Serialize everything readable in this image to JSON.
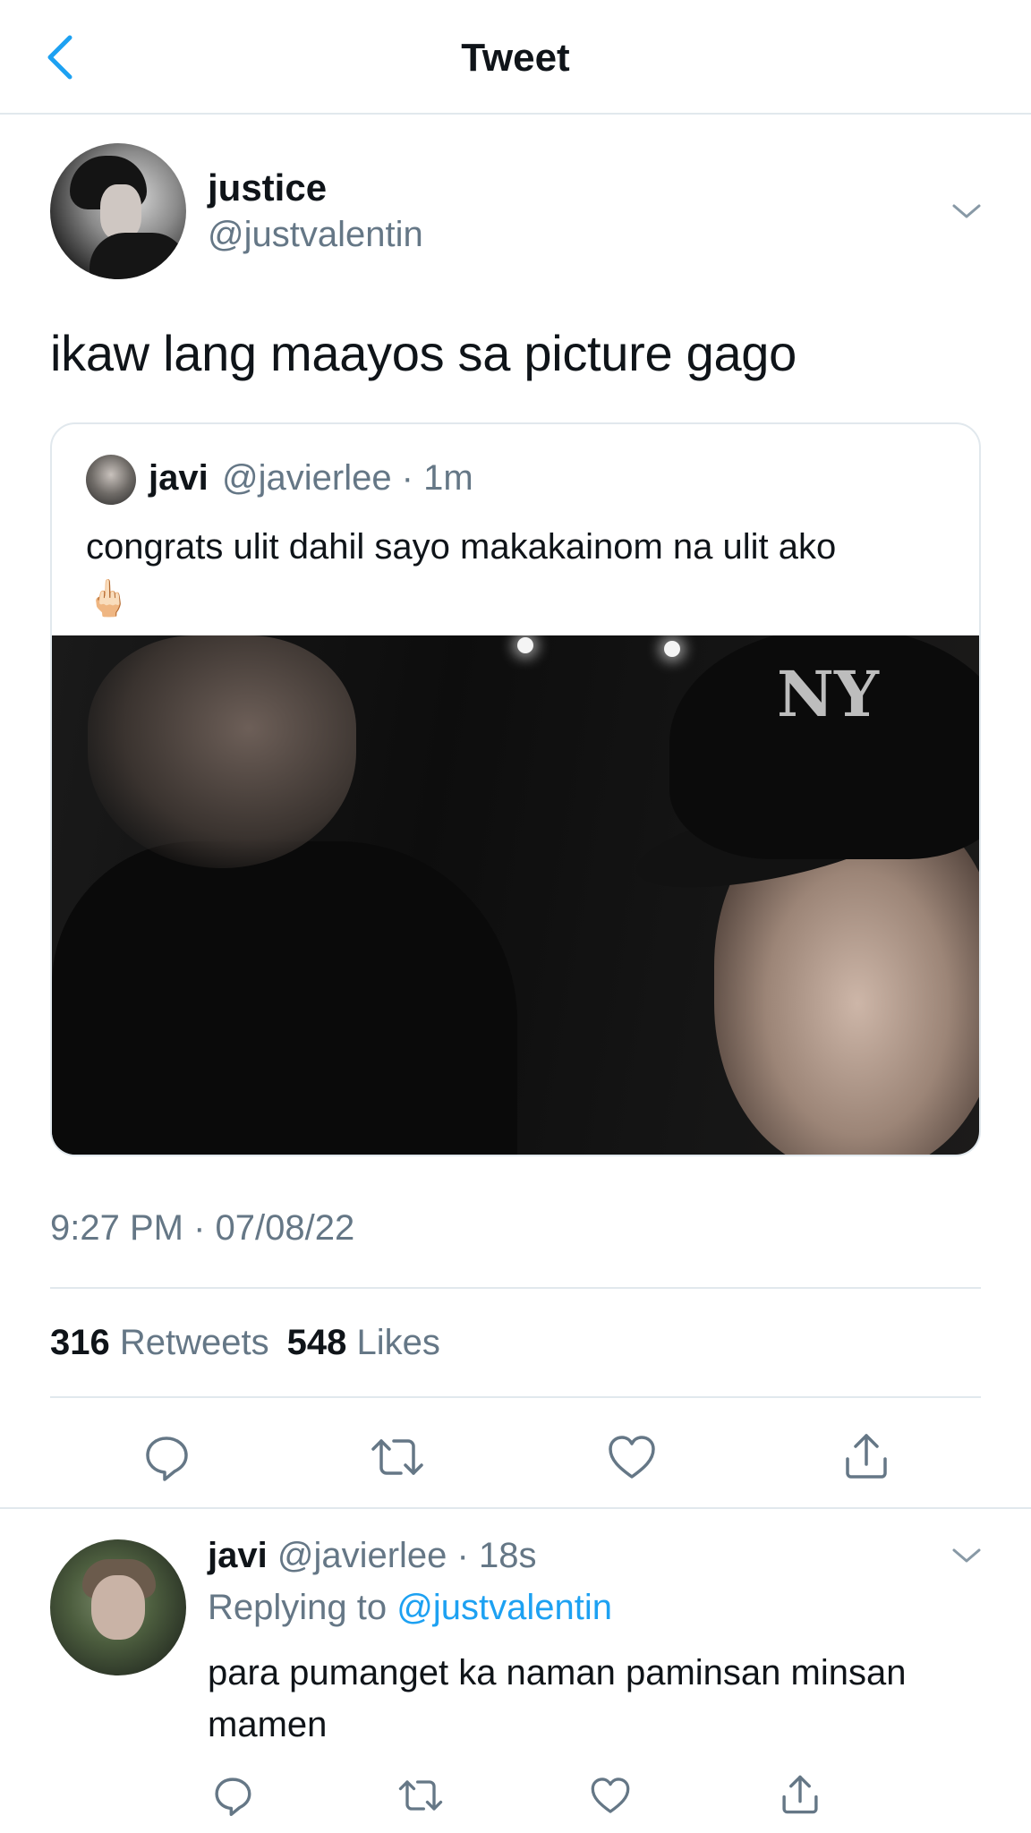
{
  "nav": {
    "title": "Tweet",
    "back_icon": "chevron-left-icon",
    "accent": "#1da1f2"
  },
  "tweet": {
    "author_name": "justice",
    "author_handle": "@justvalentin",
    "text": "ikaw lang maayos sa picture gago",
    "timestamp": "9:27 PM · 07/08/22",
    "retweets_count": "316",
    "retweets_label": "Retweets",
    "likes_count": "548",
    "likes_label": "Likes",
    "quoted": {
      "author_name": "javi",
      "meta": "@javierlee · 1m",
      "text": "congrats ulit dahil sayo makakainom na ulit ako",
      "emoji": "🖕🏻",
      "photo_logo": "NY"
    }
  },
  "actions": [
    "reply-icon",
    "retweet-icon",
    "like-icon",
    "share-icon"
  ],
  "reply": {
    "author_name": "javi",
    "meta": "@javierlee · 18s",
    "replying_prefix": "Replying to",
    "replying_to": "@justvalentin",
    "text": "para pumanget ka naman paminsan minsan mamen"
  },
  "colors": {
    "text": "#0f1419",
    "secondary": "#657786",
    "divider": "#e1e8ed",
    "link": "#1da1f2"
  }
}
